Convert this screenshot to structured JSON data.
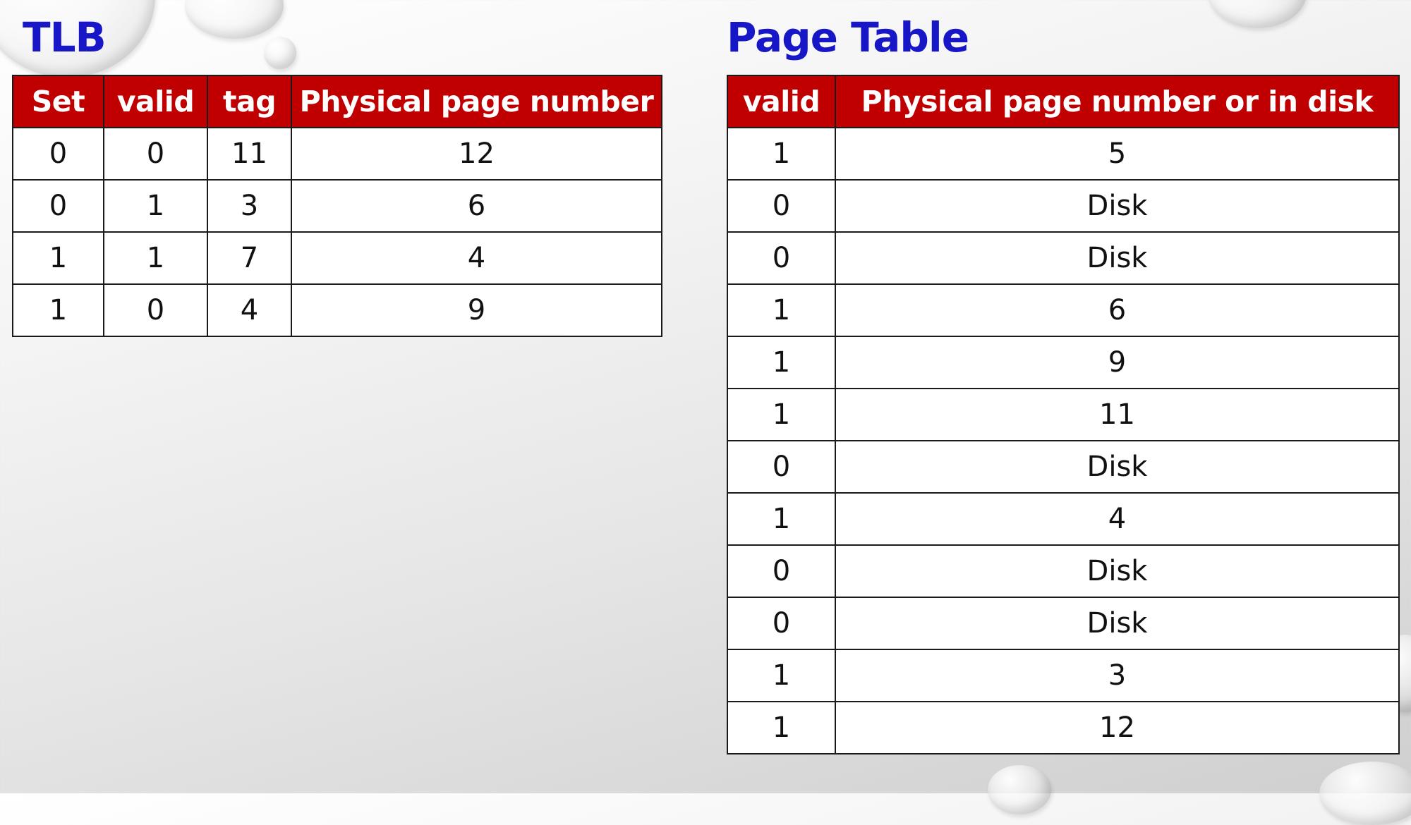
{
  "tlb": {
    "title": "TLB",
    "headers": [
      "Set",
      "valid",
      "tag",
      "Physical page number"
    ],
    "rows": [
      [
        "0",
        "0",
        "11",
        "12"
      ],
      [
        "0",
        "1",
        "3",
        "6"
      ],
      [
        "1",
        "1",
        "7",
        "4"
      ],
      [
        "1",
        "0",
        "4",
        "9"
      ]
    ]
  },
  "page_table": {
    "title": "Page Table",
    "headers": [
      "valid",
      "Physical page number or in disk"
    ],
    "rows": [
      [
        "1",
        "5"
      ],
      [
        "0",
        "Disk"
      ],
      [
        "0",
        "Disk"
      ],
      [
        "1",
        "6"
      ],
      [
        "1",
        "9"
      ],
      [
        "1",
        "11"
      ],
      [
        "0",
        "Disk"
      ],
      [
        "1",
        "4"
      ],
      [
        "0",
        "Disk"
      ],
      [
        "0",
        "Disk"
      ],
      [
        "1",
        "3"
      ],
      [
        "1",
        "12"
      ]
    ]
  },
  "colors": {
    "title": "#1717c8",
    "header_bg": "#c00000",
    "header_text": "#ffffff",
    "border": "#1a1a1a"
  }
}
